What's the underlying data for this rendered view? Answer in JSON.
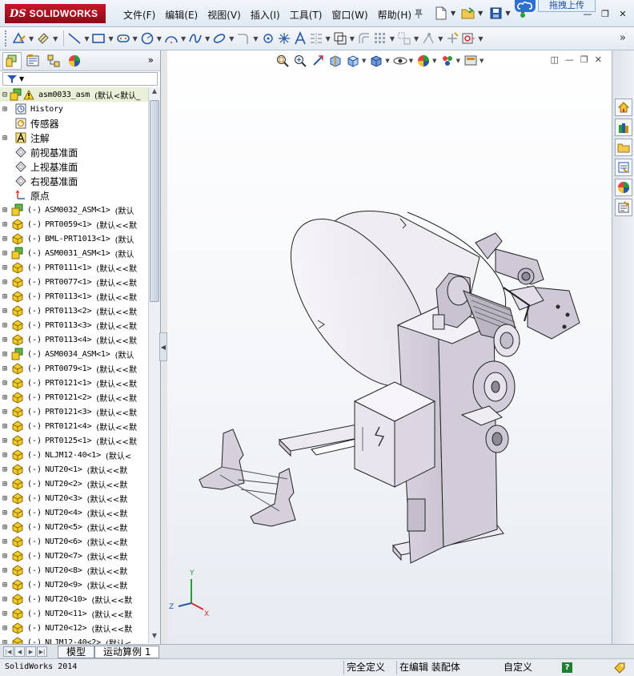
{
  "app": {
    "brand_prefix": "DS",
    "brand_name": "SOLIDWORKS",
    "upload_label": "拖拽上传"
  },
  "menus": [
    "文件(F)",
    "编辑(E)",
    "视图(V)",
    "插入(I)",
    "工具(T)",
    "窗口(W)",
    "帮助(H)"
  ],
  "icons": {
    "quick_tools": [
      "new-document-icon",
      "open-folder-icon",
      "save-icon",
      "print-icon"
    ],
    "command_tools": [
      "sketch-icon",
      "smart-dimension-icon",
      "line-icon",
      "rectangle-icon",
      "slot-icon",
      "circle-icon",
      "arc-icon",
      "spline-icon",
      "ellipse-icon",
      "fillet-icon",
      "point-icon",
      "centerline-icon",
      "text-icon",
      "mirror-icon",
      "offset-icon",
      "convert-entities-icon",
      "linear-pattern-icon",
      "move-entities-icon",
      "display-relations-icon",
      "repair-sketch-icon",
      "quick-snaps-icon"
    ],
    "heads_up": [
      "zoom-to-fit-icon",
      "zoom-area-icon",
      "previous-view-icon",
      "section-view-icon",
      "view-orientation-icon",
      "display-style-icon",
      "hide-show-icon",
      "edit-appearance-icon",
      "apply-scene-icon",
      "view-settings-icon"
    ],
    "task_pane": [
      "solidworks-resources-icon",
      "design-library-icon",
      "file-explorer-icon",
      "view-palette-icon",
      "appearances-icon",
      "custom-properties-icon"
    ]
  },
  "panel": {
    "root_label": "asm0033_asm",
    "root_config": "(默认<默认_",
    "fixed_items": [
      {
        "label": "History",
        "icon": "history-icon",
        "cjk": false
      },
      {
        "label": "传感器",
        "icon": "sensor-icon",
        "cjk": true
      },
      {
        "label": "注解",
        "icon": "annotation-icon",
        "cjk": true
      },
      {
        "label": "前视基准面",
        "icon": "plane-icon",
        "cjk": true
      },
      {
        "label": "上视基准面",
        "icon": "plane-icon",
        "cjk": true
      },
      {
        "label": "右视基准面",
        "icon": "plane-icon",
        "cjk": true
      },
      {
        "label": "原点",
        "icon": "origin-icon",
        "cjk": true
      }
    ],
    "components": [
      {
        "state": "(-)",
        "name": "ASM0032_ASM<1>",
        "config": "(默认",
        "type": "assembly"
      },
      {
        "state": "(-)",
        "name": "PRT0059<1>",
        "config": "(默认<<默",
        "type": "part"
      },
      {
        "state": "(-)",
        "name": "BML-PRT1013<1>",
        "config": "(默认",
        "type": "part"
      },
      {
        "state": "(-)",
        "name": "ASM0031_ASM<1>",
        "config": "(默认",
        "type": "assembly"
      },
      {
        "state": "(-)",
        "name": "PRT0111<1>",
        "config": "(默认<<默",
        "type": "part"
      },
      {
        "state": "(-)",
        "name": "PRT0077<1>",
        "config": "(默认<<默",
        "type": "part"
      },
      {
        "state": "(-)",
        "name": "PRT0113<1>",
        "config": "(默认<<默",
        "type": "part"
      },
      {
        "state": "(-)",
        "name": "PRT0113<2>",
        "config": "(默认<<默",
        "type": "part"
      },
      {
        "state": "(-)",
        "name": "PRT0113<3>",
        "config": "(默认<<默",
        "type": "part"
      },
      {
        "state": "(-)",
        "name": "PRT0113<4>",
        "config": "(默认<<默",
        "type": "part"
      },
      {
        "state": "(-)",
        "name": "ASM0034_ASM<1>",
        "config": "(默认",
        "type": "assembly"
      },
      {
        "state": "(-)",
        "name": "PRT0079<1>",
        "config": "(默认<<默",
        "type": "part"
      },
      {
        "state": "(-)",
        "name": "PRT0121<1>",
        "config": "(默认<<默",
        "type": "part"
      },
      {
        "state": "(-)",
        "name": "PRT0121<2>",
        "config": "(默认<<默",
        "type": "part"
      },
      {
        "state": "(-)",
        "name": "PRT0121<3>",
        "config": "(默认<<默",
        "type": "part"
      },
      {
        "state": "(-)",
        "name": "PRT0121<4>",
        "config": "(默认<<默",
        "type": "part"
      },
      {
        "state": "(-)",
        "name": "PRT0125<1>",
        "config": "(默认<<默",
        "type": "part"
      },
      {
        "state": "(-)",
        "name": "NLJM12-40<1>",
        "config": "(默认<",
        "type": "part"
      },
      {
        "state": "(-)",
        "name": "NUT20<1>",
        "config": "(默认<<默",
        "type": "part"
      },
      {
        "state": "(-)",
        "name": "NUT20<2>",
        "config": "(默认<<默",
        "type": "part"
      },
      {
        "state": "(-)",
        "name": "NUT20<3>",
        "config": "(默认<<默",
        "type": "part"
      },
      {
        "state": "(-)",
        "name": "NUT20<4>",
        "config": "(默认<<默",
        "type": "part"
      },
      {
        "state": "(-)",
        "name": "NUT20<5>",
        "config": "(默认<<默",
        "type": "part"
      },
      {
        "state": "(-)",
        "name": "NUT20<6>",
        "config": "(默认<<默",
        "type": "part"
      },
      {
        "state": "(-)",
        "name": "NUT20<7>",
        "config": "(默认<<默",
        "type": "part"
      },
      {
        "state": "(-)",
        "name": "NUT20<8>",
        "config": "(默认<<默",
        "type": "part"
      },
      {
        "state": "(-)",
        "name": "NUT20<9>",
        "config": "(默认<<默",
        "type": "part"
      },
      {
        "state": "(-)",
        "name": "NUT20<10>",
        "config": "(默认<<默",
        "type": "part"
      },
      {
        "state": "(-)",
        "name": "NUT20<11>",
        "config": "(默认<<默",
        "type": "part"
      },
      {
        "state": "(-)",
        "name": "NUT20<12>",
        "config": "(默认<<默",
        "type": "part"
      },
      {
        "state": "(-)",
        "name": "NLJM12-40<2>",
        "config": "(默认<",
        "type": "part"
      }
    ]
  },
  "bottom_tabs": [
    "模型",
    "运动算例 1"
  ],
  "status": {
    "app_version": "SolidWorks 2014",
    "definition": "完全定义",
    "editing": "在编辑 装配体",
    "units": "自定义",
    "help": "?"
  },
  "colors": {
    "brand_red": "#c8162a",
    "model_fill": "#e7e2ec",
    "model_dark": "#8f8996",
    "assembly_icon": "#4aa83a",
    "part_icon": "#e2c02a"
  }
}
